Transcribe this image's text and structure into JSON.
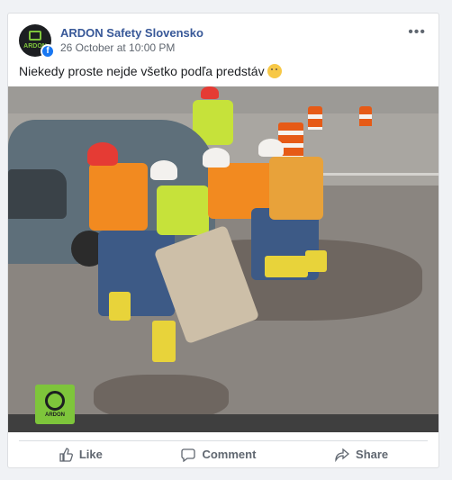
{
  "post": {
    "page_name": "ARDON Safety Slovensko",
    "timestamp": "26 October at 10:00 PM",
    "text": "Niekedy proste nejde všetko podľa predstáv",
    "avatar_text": "ARDON",
    "badge": "f",
    "more": "•••"
  },
  "image": {
    "logo_text": "ARDON"
  },
  "actions": {
    "like": "Like",
    "comment": "Comment",
    "share": "Share"
  },
  "colors": {
    "brand_green": "#7ec53b",
    "link_blue": "#385898",
    "facebook_blue": "#1877f2"
  }
}
